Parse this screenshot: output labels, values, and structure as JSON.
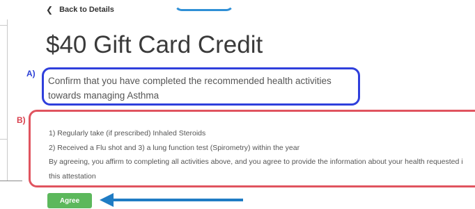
{
  "nav": {
    "back_label": "Back to Details",
    "back_icon": "chevron-left-icon"
  },
  "header": {
    "title": "$40 Gift Card Credit"
  },
  "annotations": {
    "a_label": "A)",
    "b_label": "B)",
    "a_color": "#2f3fdc",
    "b_color": "#e0545f",
    "arrow_color": "#1f7cc4"
  },
  "confirm": {
    "lines": [
      "Confirm that you have completed the recommended health activities",
      "towards managing Asthma"
    ]
  },
  "attestation": {
    "items": [
      "1) Regularly take (if prescribed) Inhaled Steroids",
      "2) Received a Flu shot and 3) a lung function test (Spirometry) within the year",
      "By agreeing, you affirm to completing all activities above, and you agree to provide the information about your health requested i",
      "this attestation"
    ]
  },
  "actions": {
    "agree_label": "Agree",
    "agree_color": "#5cb85c"
  }
}
